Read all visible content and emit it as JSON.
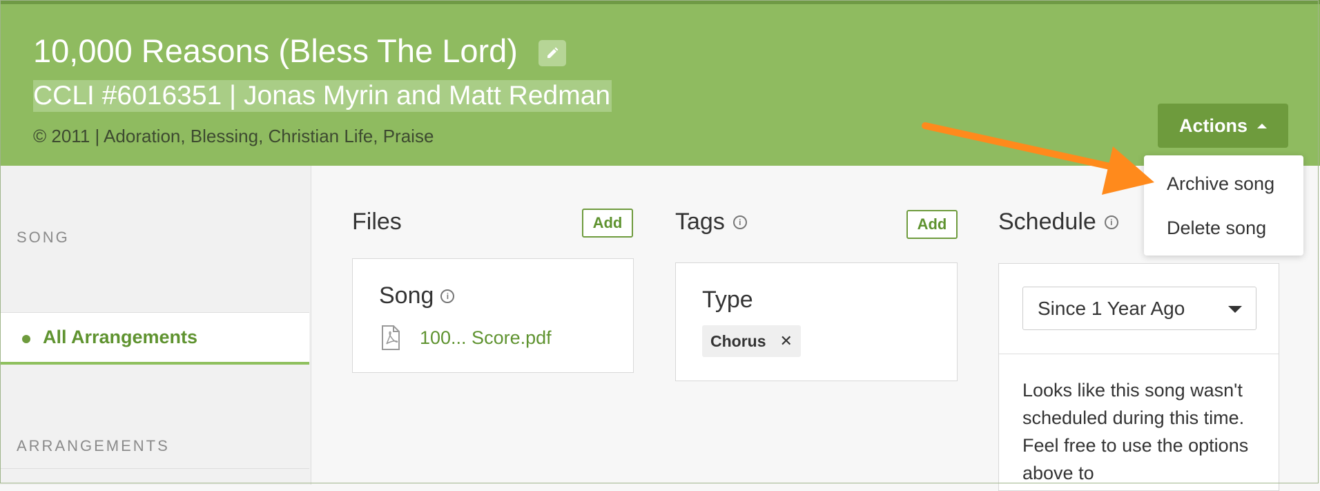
{
  "header": {
    "title": "10,000 Reasons (Bless The Lord)",
    "subtitle": "CCLI #6016351 | Jonas Myrin and Matt Redman",
    "meta": "© 2011 | Adoration, Blessing, Christian Life, Praise",
    "actions_label": "Actions"
  },
  "dropdown": {
    "items": [
      "Archive song",
      "Delete song"
    ]
  },
  "sidebar": {
    "song_heading": "SONG",
    "active_item": "All Arrangements",
    "arrangements_heading": "ARRANGEMENTS"
  },
  "files": {
    "title": "Files",
    "add_label": "Add",
    "card_title": "Song",
    "file_name": "100... Score.pdf"
  },
  "tags": {
    "title": "Tags",
    "add_label": "Add",
    "card_title": "Type",
    "chip_label": "Chorus",
    "chip_remove": "✕"
  },
  "schedule": {
    "title": "Schedule",
    "select_value": "Since 1 Year Ago",
    "empty_text": "Looks like this song wasn't scheduled during this time. Feel free to use the options above to"
  },
  "colors": {
    "header_bg": "#8fbb60",
    "accent": "#6e9b3d",
    "link": "#5f9330",
    "annotation_arrow": "#ff8a1c"
  },
  "icons": {
    "edit": "pencil-icon",
    "info": "info-icon",
    "file": "pdf-file-icon",
    "caret": "caret-icon"
  }
}
